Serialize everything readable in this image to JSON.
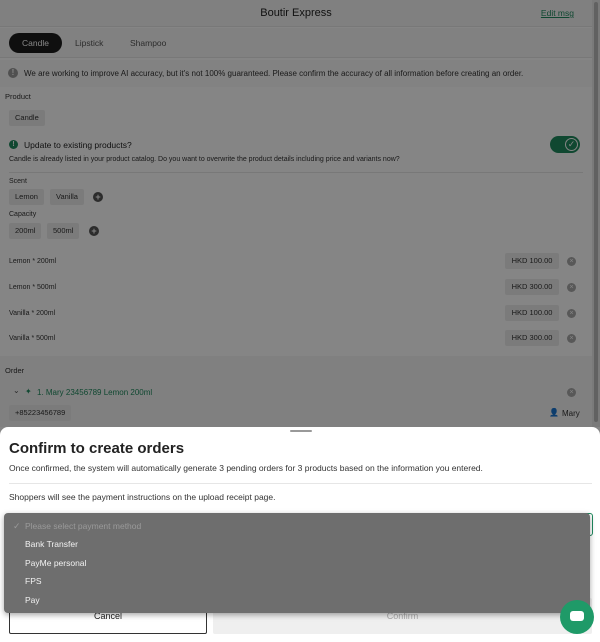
{
  "header": {
    "title": "Boutir Express",
    "edit_label": "Edit msg"
  },
  "tabs": [
    {
      "label": "Candle",
      "active": true
    },
    {
      "label": "Lipstick"
    },
    {
      "label": "Shampoo"
    }
  ],
  "notice": {
    "text": "We are working to improve AI accuracy, but it's not 100% guaranteed. Please confirm the accuracy of all information before creating an order."
  },
  "product": {
    "section_label": "Product",
    "name": "Candle",
    "update": {
      "title": "Update to existing products?",
      "description": "Candle is already listed in your product catalog. Do you want to overwrite the product details including price and variants now?",
      "toggle_on": true
    },
    "options": [
      {
        "label": "Scent",
        "values": [
          "Lemon",
          "Vanilla"
        ]
      },
      {
        "label": "Capacity",
        "values": [
          "200ml",
          "500ml"
        ]
      }
    ],
    "variants": [
      {
        "name": "Lemon * 200ml",
        "price": "HKD 100.00"
      },
      {
        "name": "Lemon * 500ml",
        "price": "HKD 300.00"
      },
      {
        "name": "Vanilla * 200ml",
        "price": "HKD 100.00"
      },
      {
        "name": "Vanilla * 500ml",
        "price": "HKD 300.00"
      }
    ]
  },
  "order": {
    "section_label": "Order",
    "items": [
      {
        "title": "1. Mary 23456789 Lemon 200ml",
        "phone": "+85223456789",
        "customer": "Mary"
      }
    ]
  },
  "sheet": {
    "title": "Confirm to create orders",
    "description": "Once confirmed, the system will automatically generate 3 pending orders for 3 products based on the information you entered.",
    "payment_note": "Shoppers will see the payment instructions on the upload receipt page.",
    "select_placeholder": "Please select payment method",
    "options": [
      "Bank Transfer",
      "PayMe personal",
      "FPS",
      "Pay"
    ],
    "cancel_label": "Cancel",
    "confirm_label": "Confirm"
  },
  "colors": {
    "accent": "#1f8a5e",
    "overlay": "rgba(0,0,0,0.48)"
  }
}
